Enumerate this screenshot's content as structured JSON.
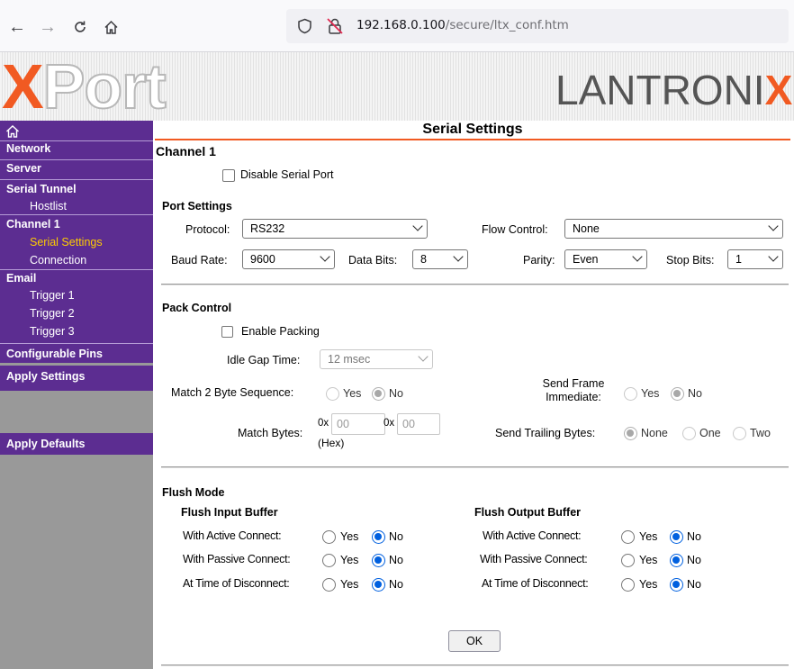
{
  "browser": {
    "url_host": "192.168.0.100",
    "url_path": "/secure/ltx_conf.htm"
  },
  "banner": {
    "product_x": "X",
    "product_rest": "Port",
    "brand_main": "LANTRONI",
    "brand_x": "X"
  },
  "sidebar": {
    "home_icon": "home-icon",
    "network": "Network",
    "server": "Server",
    "serial_tunnel": "Serial Tunnel",
    "hostlist": "Hostlist",
    "channel1": "Channel 1",
    "serial_settings": "Serial Settings",
    "connection": "Connection",
    "email": "Email",
    "trigger1": "Trigger 1",
    "trigger2": "Trigger 2",
    "trigger3": "Trigger 3",
    "configurable_pins": "Configurable Pins",
    "apply_settings": "Apply Settings",
    "apply_defaults": "Apply Defaults"
  },
  "page": {
    "title": "Serial Settings",
    "channel": "Channel 1",
    "disable_serial_port": "Disable Serial Port"
  },
  "port_settings": {
    "heading": "Port Settings",
    "protocol_label": "Protocol:",
    "protocol_value": "RS232",
    "flow_control_label": "Flow Control:",
    "flow_control_value": "None",
    "baud_rate_label": "Baud Rate:",
    "baud_rate_value": "9600",
    "data_bits_label": "Data Bits:",
    "data_bits_value": "8",
    "parity_label": "Parity:",
    "parity_value": "Even",
    "stop_bits_label": "Stop Bits:",
    "stop_bits_value": "1"
  },
  "pack_control": {
    "heading": "Pack Control",
    "enable_packing": "Enable Packing",
    "idle_gap_label": "Idle Gap Time:",
    "idle_gap_value": "12 msec",
    "match2_label": "Match 2 Byte Sequence:",
    "yes": "Yes",
    "no": "No",
    "send_frame_line1": "Send Frame",
    "send_frame_line2": "Immediate:",
    "match_bytes_label": "Match Bytes:",
    "hex_prefix": "0x",
    "byte1_placeholder": "00",
    "byte2_placeholder": "00",
    "hex_note": "(Hex)",
    "trailing_label": "Send Trailing Bytes:",
    "none": "None",
    "one": "One",
    "two": "Two"
  },
  "flush_mode": {
    "heading": "Flush Mode",
    "input_heading": "Flush Input Buffer",
    "output_heading": "Flush Output Buffer",
    "active": "With Active Connect:",
    "passive": "With Passive Connect:",
    "disconnect": "At Time of Disconnect:",
    "yes": "Yes",
    "no": "No"
  },
  "ok_button": "OK",
  "colors": {
    "sidebar_purple": "#5c2d91",
    "accent_orange": "#f15a22",
    "active_yellow": "#ffcc00",
    "radio_blue": "#0060df"
  }
}
